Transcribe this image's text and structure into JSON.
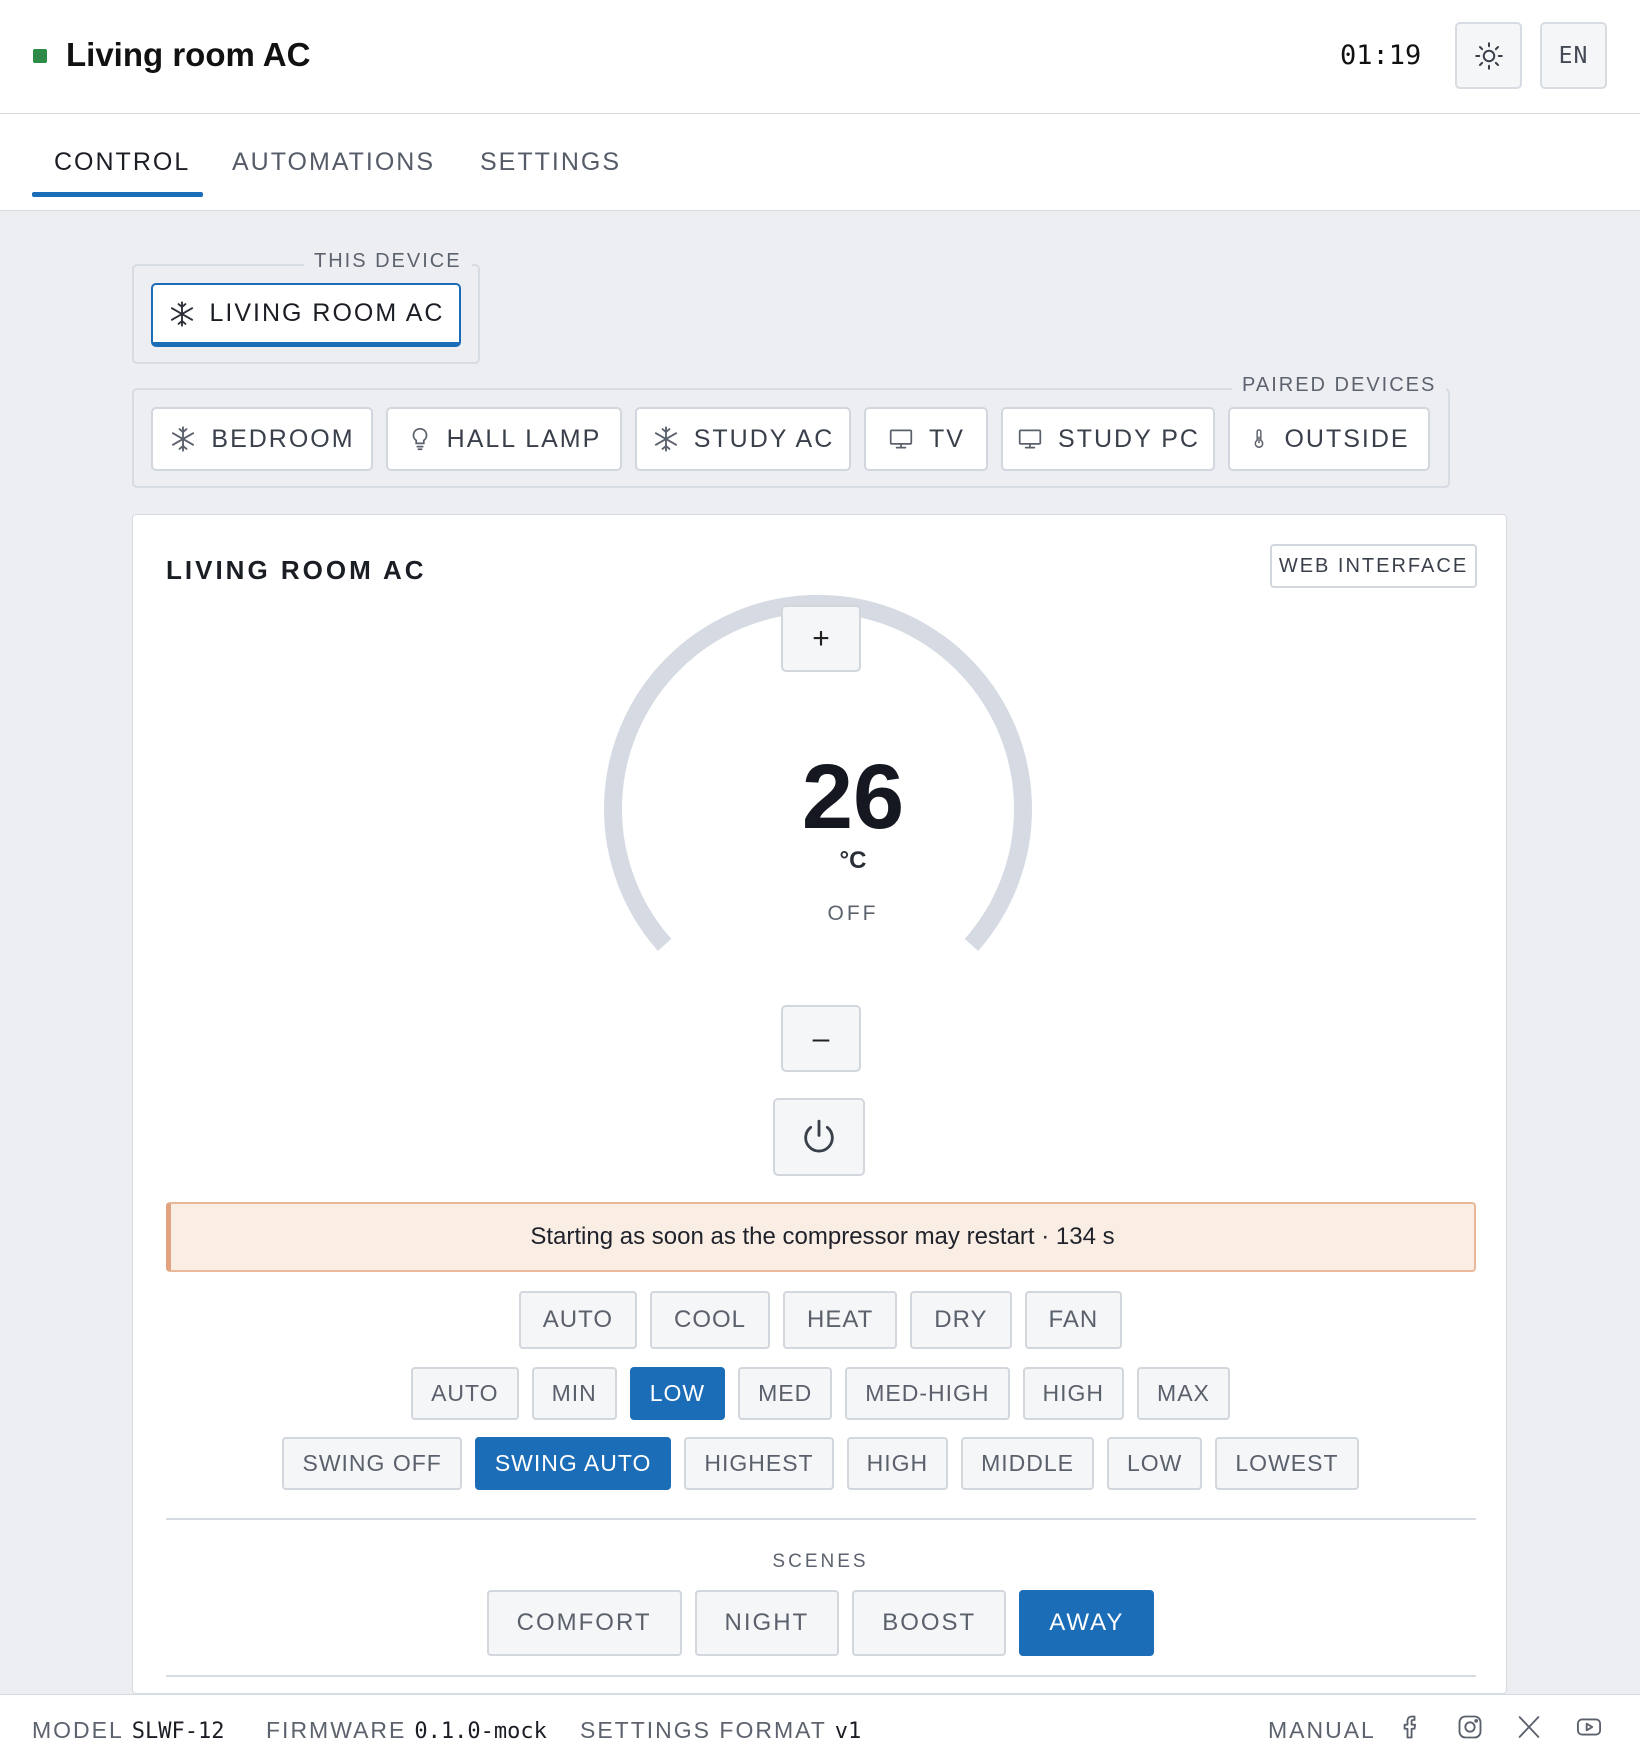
{
  "header": {
    "title": "Living room AC",
    "status_color": "#2e8b45",
    "time": "01:19",
    "theme_icon": "sun-icon",
    "language": "EN"
  },
  "tabs": [
    {
      "label": "CONTROL",
      "active": true
    },
    {
      "label": "AUTOMATIONS",
      "active": false
    },
    {
      "label": "SETTINGS",
      "active": false
    }
  ],
  "this_device": {
    "legend": "THIS DEVICE",
    "button": {
      "label": "LIVING ROOM AC",
      "icon": "snowflake-icon"
    }
  },
  "paired_devices": {
    "legend": "PAIRED DEVICES",
    "items": [
      {
        "label": "BEDROOM",
        "icon": "snowflake-icon"
      },
      {
        "label": "HALL LAMP",
        "icon": "lightbulb-icon"
      },
      {
        "label": "STUDY AC",
        "icon": "snowflake-icon"
      },
      {
        "label": "TV",
        "icon": "monitor-icon"
      },
      {
        "label": "STUDY PC",
        "icon": "monitor-icon"
      },
      {
        "label": "OUTSIDE",
        "icon": "thermometer-icon"
      }
    ]
  },
  "panel": {
    "title": "LIVING ROOM AC",
    "web_interface": "WEB INTERFACE",
    "increase": "+",
    "decrease": "–",
    "temperature": "26",
    "unit": "°C",
    "state": "OFF",
    "power_icon": "power-icon",
    "notice": "Starting as soon as the compressor may restart · 134 s",
    "modes": [
      {
        "label": "AUTO",
        "active": false
      },
      {
        "label": "COOL",
        "active": false
      },
      {
        "label": "HEAT",
        "active": false
      },
      {
        "label": "DRY",
        "active": false
      },
      {
        "label": "FAN",
        "active": false
      }
    ],
    "fan_speeds": [
      {
        "label": "AUTO",
        "active": false
      },
      {
        "label": "MIN",
        "active": false
      },
      {
        "label": "LOW",
        "active": true
      },
      {
        "label": "MED",
        "active": false
      },
      {
        "label": "MED-HIGH",
        "active": false
      },
      {
        "label": "HIGH",
        "active": false
      },
      {
        "label": "MAX",
        "active": false
      }
    ],
    "swing": [
      {
        "label": "SWING OFF",
        "active": false
      },
      {
        "label": "SWING AUTO",
        "active": true
      },
      {
        "label": "HIGHEST",
        "active": false
      },
      {
        "label": "HIGH",
        "active": false
      },
      {
        "label": "MIDDLE",
        "active": false
      },
      {
        "label": "LOW",
        "active": false
      },
      {
        "label": "LOWEST",
        "active": false
      }
    ],
    "scenes_label": "SCENES",
    "scenes": [
      {
        "label": "COMFORT",
        "active": false
      },
      {
        "label": "NIGHT",
        "active": false
      },
      {
        "label": "BOOST",
        "active": false
      },
      {
        "label": "AWAY",
        "active": true
      }
    ]
  },
  "footer": {
    "model_label": "MODEL",
    "model": "SLWF-12",
    "firmware_label": "FIRMWARE",
    "firmware": "0.1.0-mock",
    "format_label": "SETTINGS FORMAT",
    "format": "v1",
    "manual": "MANUAL",
    "social_icons": [
      "facebook-icon",
      "instagram-icon",
      "x-icon",
      "youtube-icon"
    ]
  },
  "colors": {
    "accent": "#1c6db8",
    "notice_bg": "#f9ede4",
    "notice_border": "#e0a27f",
    "dial_track": "#d6dae3"
  }
}
